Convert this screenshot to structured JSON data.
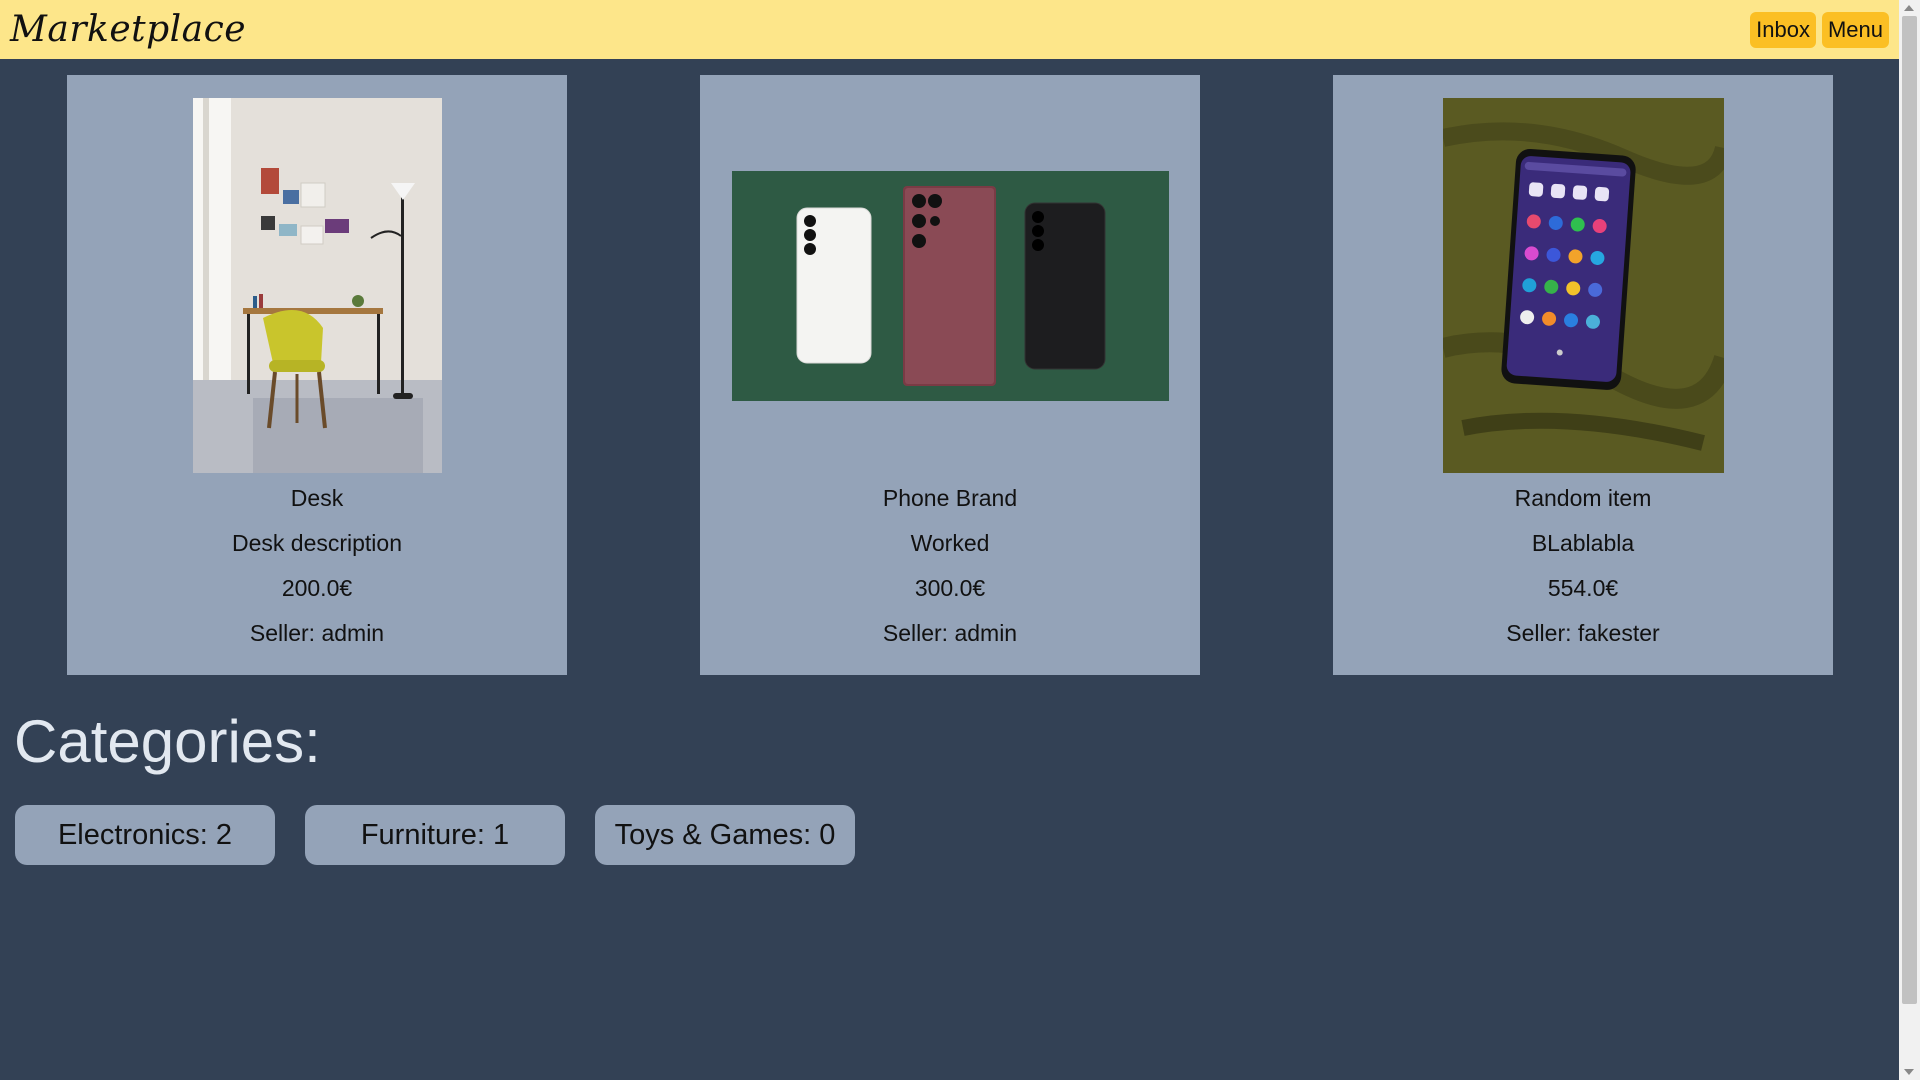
{
  "header": {
    "brand": "Marketplace",
    "inbox_label": "Inbox",
    "menu_label": "Menu"
  },
  "listings": [
    {
      "title": "Desk",
      "description": "Desk description",
      "price": "200.0€",
      "seller": "Seller: admin",
      "image": "desk-photo"
    },
    {
      "title": "Phone Brand",
      "description": "Worked",
      "price": "300.0€",
      "seller": "Seller: admin",
      "image": "phones-photo"
    },
    {
      "title": "Random item",
      "description": "BLablabla",
      "price": "554.0€",
      "seller": "Seller: fakester",
      "image": "phone-on-fabric-photo"
    }
  ],
  "categories": {
    "heading": "Categories:",
    "items": [
      {
        "label": "Electronics: 2"
      },
      {
        "label": "Furniture: 1"
      },
      {
        "label": "Toys & Games: 0"
      }
    ]
  },
  "colors": {
    "page_bg": "#334155",
    "header_bg": "#fde68a",
    "header_button": "#fbbf24",
    "card_bg": "#94a3b8"
  }
}
